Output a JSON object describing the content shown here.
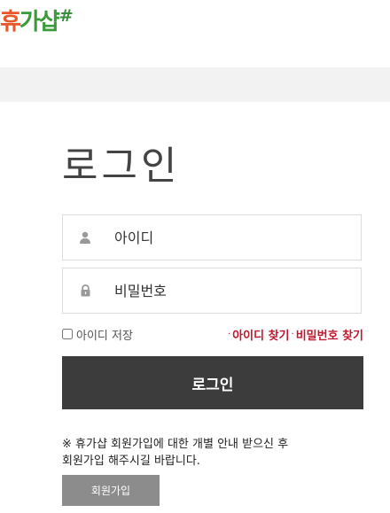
{
  "header": {
    "logo_first": "휴",
    "logo_rest": "가샵",
    "logo_mark": "#"
  },
  "login": {
    "title": "로그인",
    "id_placeholder": "아이디",
    "password_placeholder": "비밀번호",
    "save_id_label": "아이디 저장",
    "find_id_label": "아이디 찾기",
    "find_password_label": "비밀번호 찾기",
    "separator": "·",
    "submit_label": "로그인"
  },
  "signup": {
    "notice_line1": "※ 휴가샵 회원가입에 대한 개별 안내 받으신 후",
    "notice_line2": "회원가입 해주시길 바랍니다.",
    "button_label": "회원가입"
  },
  "colors": {
    "accent_red": "#c0172f",
    "button_dark": "#3c3c3c",
    "button_grey": "#8c8c8c",
    "logo_green": "#3a9a3a",
    "logo_orange": "#e8572a"
  },
  "icons": {
    "id_field": "user-icon",
    "password_field": "lock-icon"
  }
}
